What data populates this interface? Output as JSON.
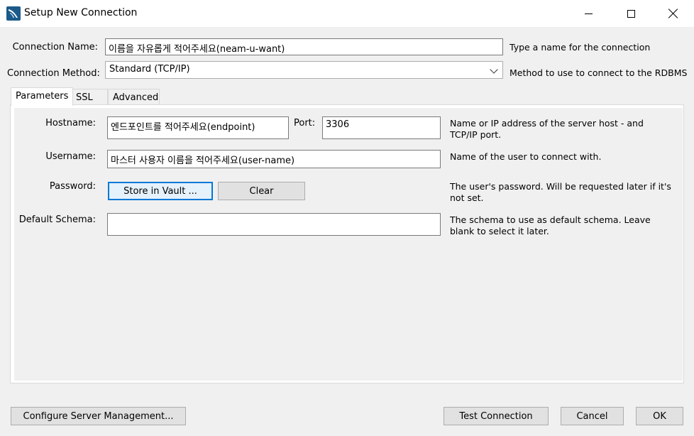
{
  "window": {
    "title": "Setup New Connection",
    "icon": "mysql-workbench-dolphin-icon"
  },
  "connection_name": {
    "label": "Connection Name:",
    "value": "이름을 자유롭게 적어주세요(neam-u-want)",
    "hint": "Type a name for the connection"
  },
  "connection_method": {
    "label": "Connection Method:",
    "value": "Standard (TCP/IP)",
    "hint": "Method to use to connect to the RDBMS"
  },
  "tabs": [
    {
      "label": "Parameters",
      "active": true
    },
    {
      "label": "SSL",
      "active": false
    },
    {
      "label": "Advanced",
      "active": false
    }
  ],
  "parameters": {
    "hostname": {
      "label": "Hostname:",
      "value": "엔드포인트를 적어주세요(endpoint)",
      "hint_line1": "Name or IP address of the server host - and",
      "hint_line2": "TCP/IP port."
    },
    "port": {
      "label": "Port:",
      "value": "3306"
    },
    "username": {
      "label": "Username:",
      "value": "마스터 사용자 이름을 적어주세요(user-name)",
      "hint": "Name of the user to connect with."
    },
    "password": {
      "label": "Password:",
      "store_button": "Store in Vault ...",
      "clear_button": "Clear",
      "hint_line1": "The user's password. Will be requested later if it's",
      "hint_line2": "not set."
    },
    "default_schema": {
      "label": "Default Schema:",
      "value": "",
      "hint_line1": "The schema to use as default schema. Leave",
      "hint_line2": "blank to select it later."
    }
  },
  "footer": {
    "configure_button": "Configure Server Management...",
    "test_button": "Test Connection",
    "cancel_button": "Cancel",
    "ok_button": "OK"
  },
  "colors": {
    "window_bg": "#f0f0f0",
    "focus_border": "#0078d7",
    "icon_blue": "#1c5a8a"
  }
}
